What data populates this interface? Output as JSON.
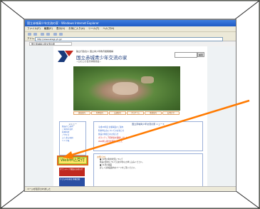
{
  "browser": {
    "window_title": "国立赤城青少年交流の家 - Windows Internet Explorer",
    "menu": [
      "ファイル(F)",
      "編集(E)",
      "表示(V)",
      "お気に入り(A)",
      "ツール(T)",
      "ヘルプ(H)"
    ],
    "address_label": "アドレス",
    "address_url": "http://www.akagi-yh.jp/",
    "tab_label": "国立赤城青少年交流の家",
    "status_text": "ページが表示されました"
  },
  "site": {
    "small_title": "独立行政法人 国立青少年教育振興機構",
    "title": "国立赤城青少年交流の家",
    "subtitle": "~山の上の自然体験施設~",
    "search_button": "検索",
    "nav": [
      "施設案内",
      "利用案内",
      "交通案内",
      "プログラム",
      "事業案内",
      "お問合せ"
    ]
  },
  "sidebar": {
    "title": "メニュー",
    "items": [
      "施設のご案内",
      "ご利用の流れ",
      "利用料金",
      "アクセス",
      "よくある質問",
      "リンク集"
    ],
    "web_button_label": "Web申込受付",
    "banner1": "ボランティア募集のお知らせ",
    "banner2": "子どもゆめ基金 体験活動"
  },
  "news": {
    "title": "国立赤城青少年交流の家 ニュース",
    "lines": [
      "平成20年度 主催事業のご案内",
      "利用申込みについてのお知らせ",
      "施設の休館日のお知らせ",
      "ボランティア研修会を開催しました",
      "Web申込受付を開始しました"
    ]
  },
  "info": {
    "head": "お知らせ",
    "lines": [
      "■ 10月の利用状況について",
      "施設の利用についてはお早めにお申し込みください。",
      "■ 11月の事業",
      "詳しくは事業案内のページをご覧ください。"
    ]
  },
  "colors": {
    "background": "#dcefc9",
    "highlight_box": "#e06a1c",
    "arrow": "#ff7a00"
  }
}
